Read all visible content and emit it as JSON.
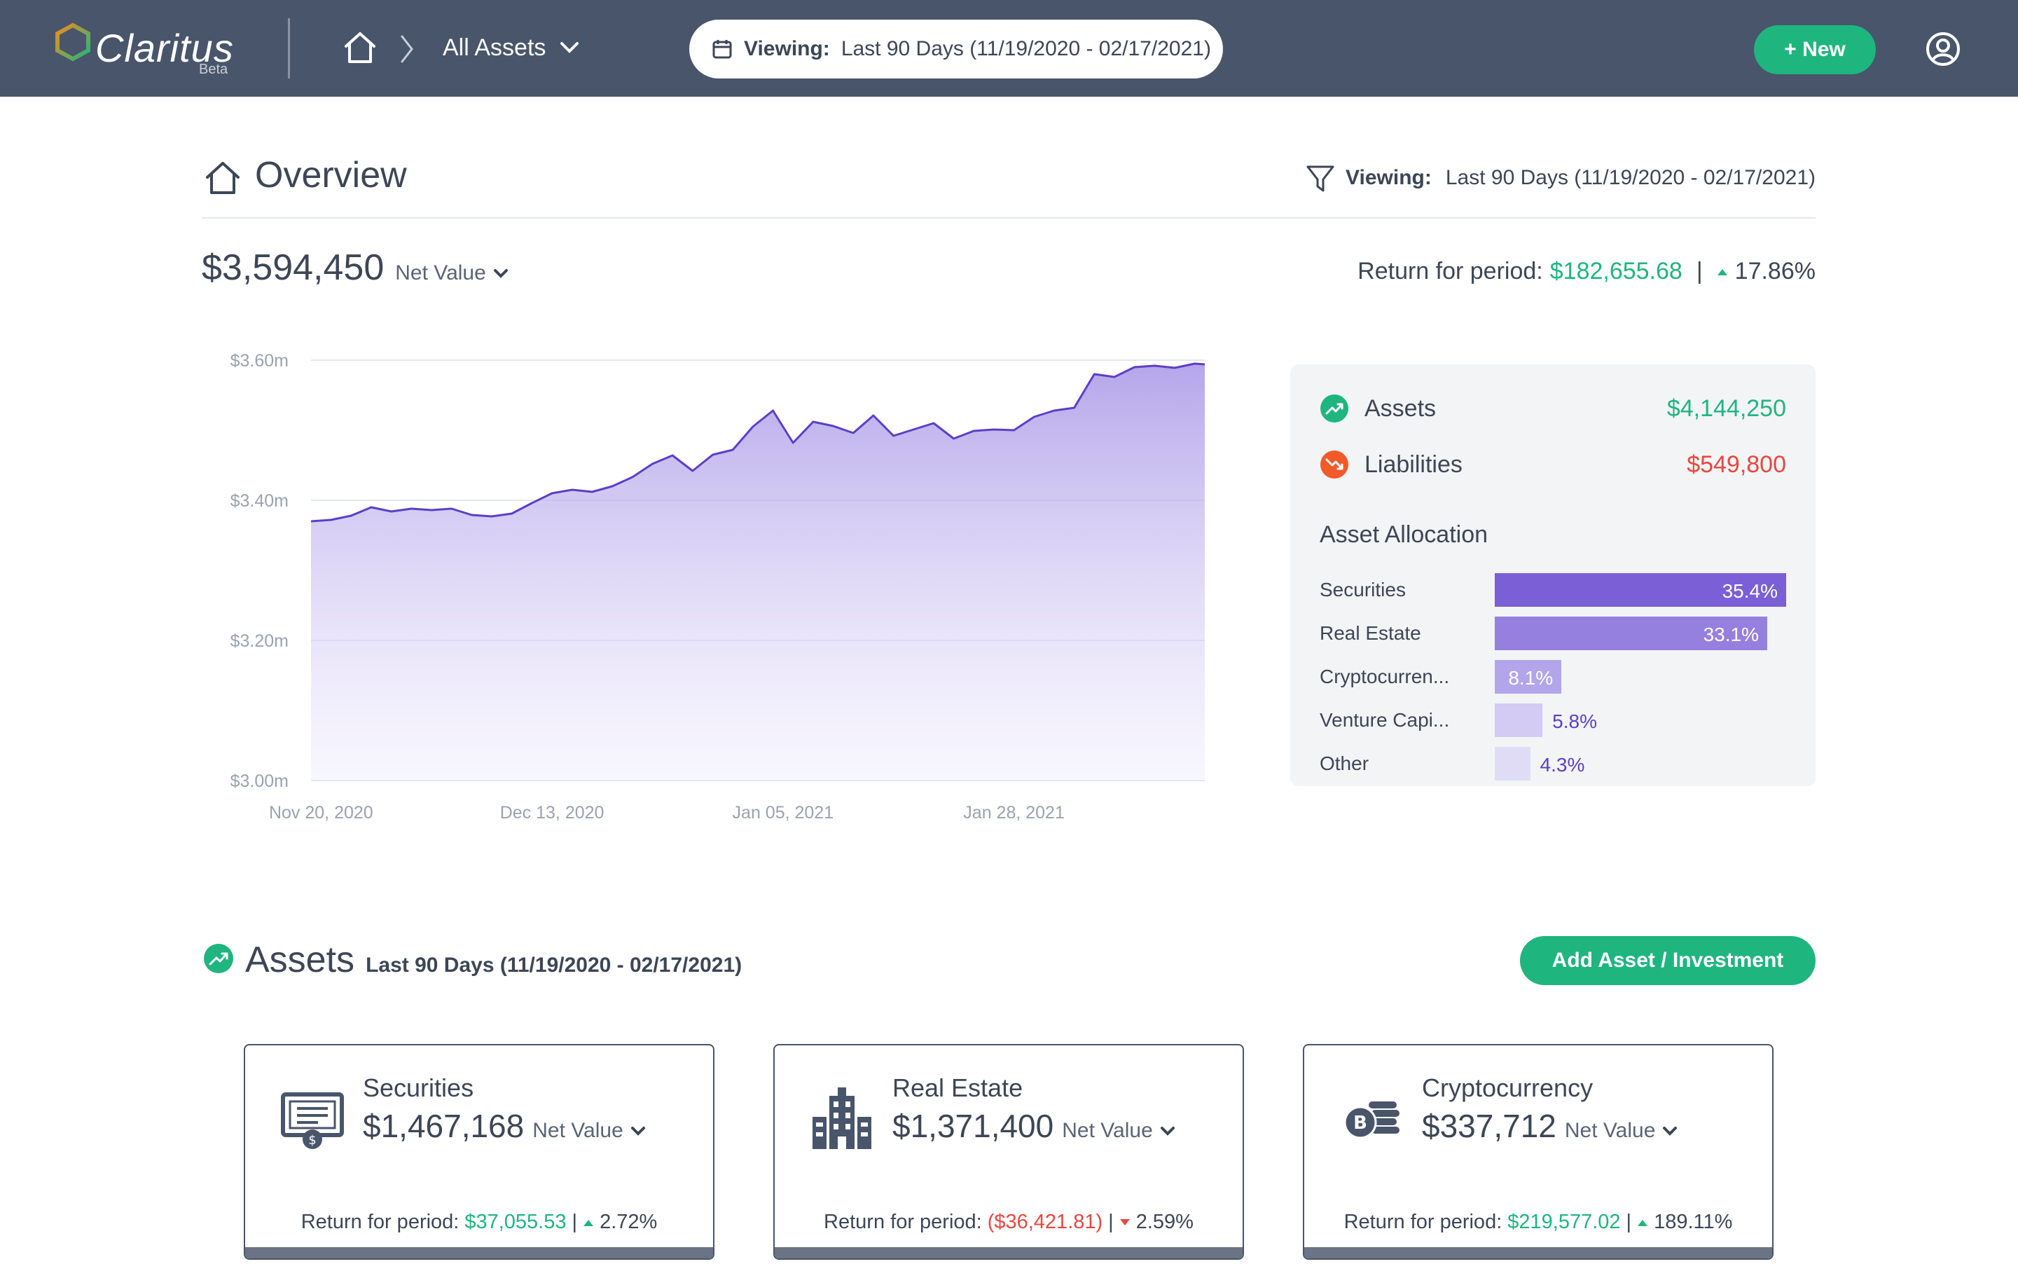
{
  "app": {
    "logo_name": "Claritus",
    "logo_badge": "Beta",
    "brand_orange": "#f28c1c",
    "brand_green": "#1fb57f",
    "topbar_color": "#49556a"
  },
  "nav": {
    "breadcrumb_current": "All Assets",
    "date_label": "Viewing:",
    "date_value": "Last 90 Days (11/19/2020 - 02/17/2021)",
    "new_button": "+ New"
  },
  "overview": {
    "title": "Overview",
    "filter_label": "Viewing:",
    "filter_value": "Last 90 Days (11/19/2020 - 02/17/2021)",
    "net_value": "$3,594,450",
    "net_value_label": "Net Value",
    "return_label": "Return for period:",
    "return_amount": "$182,655.68",
    "return_sep": "|",
    "return_pct": "17.86%"
  },
  "summary": {
    "assets_label": "Assets",
    "assets_value": "$4,144,250",
    "liabilities_label": "Liabilities",
    "liabilities_value": "$549,800",
    "allocation_title": "Asset Allocation",
    "allocation": [
      {
        "name": "Securities",
        "pct_label": "35.4%",
        "pct": 35.4,
        "color": "#7a5fd6"
      },
      {
        "name": "Real Estate",
        "pct_label": "33.1%",
        "pct": 33.1,
        "color": "#9580e0"
      },
      {
        "name": "Cryptocurren...",
        "pct_label": "8.1%",
        "pct": 8.1,
        "color": "#b3a5ea"
      },
      {
        "name": "Venture Capi...",
        "pct_label": "5.8%",
        "pct": 5.8,
        "color": "#d3cbf3"
      },
      {
        "name": "Other",
        "pct_label": "4.3%",
        "pct": 4.3,
        "color": "#e1dcf6"
      }
    ]
  },
  "chart_data": {
    "type": "area",
    "y_ticks": [
      "$3.60m",
      "$3.40m",
      "$3.20m",
      "$3.00m"
    ],
    "ylim": [
      3.0,
      3.6
    ],
    "x_ticks": [
      "Nov 20, 2020",
      "Dec 13, 2020",
      "Jan 05, 2021",
      "Jan 28, 2021"
    ],
    "x_tick_days": [
      1,
      24,
      47,
      70
    ],
    "grid": true,
    "series": [
      {
        "color": "#5b3fc9",
        "x": [
          0,
          2,
          4,
          6,
          8,
          10,
          12,
          14,
          16,
          18,
          20,
          22,
          24,
          26,
          28,
          30,
          32,
          34,
          36,
          38,
          40,
          42,
          44,
          46,
          48,
          50,
          52,
          54,
          56,
          58,
          60,
          62,
          64,
          66,
          68,
          70,
          72,
          74,
          76,
          78,
          80,
          82,
          84,
          86,
          88,
          89
        ],
        "y": [
          3.37,
          3.372,
          3.378,
          3.39,
          3.384,
          3.388,
          3.386,
          3.388,
          3.379,
          3.377,
          3.381,
          3.396,
          3.41,
          3.415,
          3.412,
          3.42,
          3.433,
          3.452,
          3.464,
          3.442,
          3.465,
          3.472,
          3.505,
          3.528,
          3.482,
          3.512,
          3.506,
          3.496,
          3.521,
          3.492,
          3.501,
          3.51,
          3.488,
          3.499,
          3.501,
          3.5,
          3.519,
          3.528,
          3.532,
          3.58,
          3.576,
          3.59,
          3.592,
          3.589,
          3.595,
          3.594
        ]
      }
    ]
  },
  "assets": {
    "title": "Assets",
    "subtitle": "Last 90 Days (11/19/2020 - 02/17/2021)",
    "add_button": "Add Asset / Investment",
    "cards": [
      {
        "name": "Securities",
        "amount": "$1,467,168",
        "nv_label": "Net Value",
        "return_label": "Return for period:",
        "return_amount": "$37,055.53",
        "return_pct": "2.72%",
        "direction": "up"
      },
      {
        "name": "Real Estate",
        "amount": "$1,371,400",
        "nv_label": "Net Value",
        "return_label": "Return for period:",
        "return_amount": "($36,421.81)",
        "return_pct": "2.59%",
        "direction": "down"
      },
      {
        "name": "Cryptocurrency",
        "amount": "$337,712",
        "nv_label": "Net Value",
        "return_label": "Return for period:",
        "return_amount": "$219,577.02",
        "return_pct": "189.11%",
        "direction": "up"
      }
    ]
  }
}
